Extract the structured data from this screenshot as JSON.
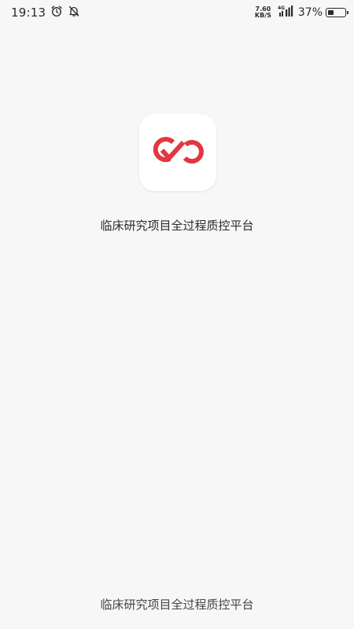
{
  "status_bar": {
    "time": "19:13",
    "alarm_icon": "alarm-clock-icon",
    "notification_icon": "notifications-off-icon",
    "net_speed_value": "7.60",
    "net_speed_unit": "KB/S",
    "network_type": "4G",
    "signal_icon": "cellular-signal-icon",
    "battery_percent": "37%",
    "battery_level": 0.37
  },
  "splash": {
    "logo_icon": "infinity-check-logo-icon",
    "app_title": "临床研究项目全过程质控平台",
    "footer_text": "临床研究项目全过程质控平台",
    "brand_color": "#e2373f"
  }
}
